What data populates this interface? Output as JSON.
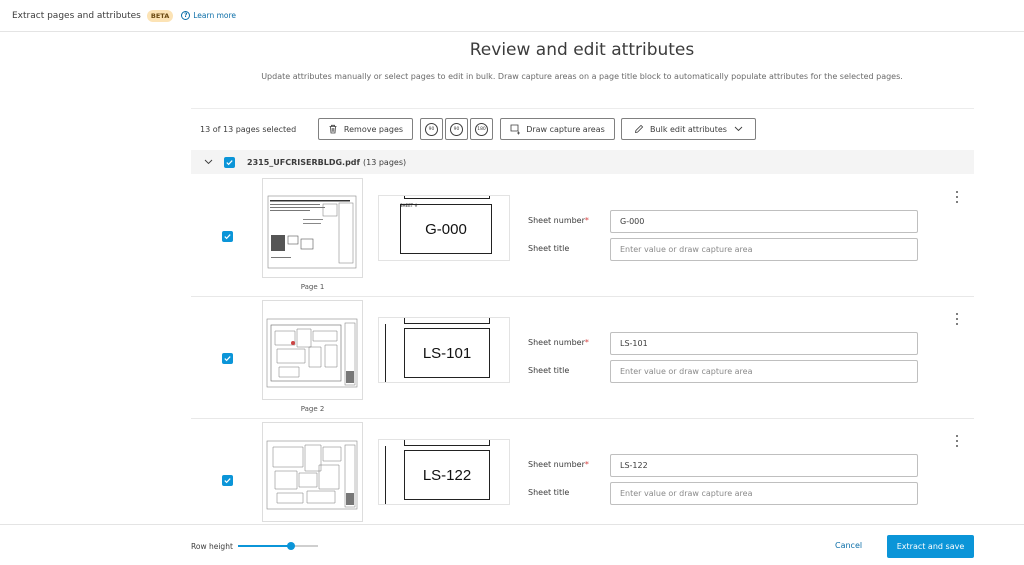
{
  "header": {
    "app_title": "Extract pages and attributes",
    "beta_badge": "BETA",
    "learn_more": "Learn more"
  },
  "main": {
    "title": "Review and edit attributes",
    "subtitle": "Update attributes manually or select pages to edit in bulk. Draw capture areas on a page title block to automatically populate attributes for the selected pages."
  },
  "toolbar": {
    "selected_count": "13 of 13 pages selected",
    "remove_pages": "Remove pages",
    "rotate_90_cw": "90",
    "rotate_90_ccw": "90",
    "rotate_180": "180",
    "draw_capture": "Draw capture areas",
    "bulk_edit": "Bulk edit attributes"
  },
  "file": {
    "name": "2315_UFCRISERBLDG.pdf",
    "pages": "(13 pages)",
    "checked": true
  },
  "fields": {
    "sheet_number_label": "Sheet number",
    "required_mark": "*",
    "sheet_title_label": "Sheet title",
    "sheet_title_placeholder": "Enter value or draw capture area"
  },
  "pages": [
    {
      "page_label": "Page 1",
      "crop_text": "G-000",
      "crop_small": "SHEET #",
      "sheet_number": "G-000",
      "sheet_title": "",
      "checked": true
    },
    {
      "page_label": "Page 2",
      "crop_text": "LS-101",
      "crop_small": "",
      "sheet_number": "LS-101",
      "sheet_title": "",
      "checked": true
    },
    {
      "page_label": "",
      "crop_text": "LS-122",
      "crop_small": "",
      "sheet_number": "LS-122",
      "sheet_title": "",
      "checked": true
    }
  ],
  "footer": {
    "row_height_label": "Row height",
    "row_height_level": 0.66,
    "cancel": "Cancel",
    "extract_save": "Extract and save"
  },
  "colors": {
    "accent": "#0b95d8",
    "link": "#0b6ea8",
    "beta_bg": "#fce3b5",
    "required": "#d53f3f"
  }
}
